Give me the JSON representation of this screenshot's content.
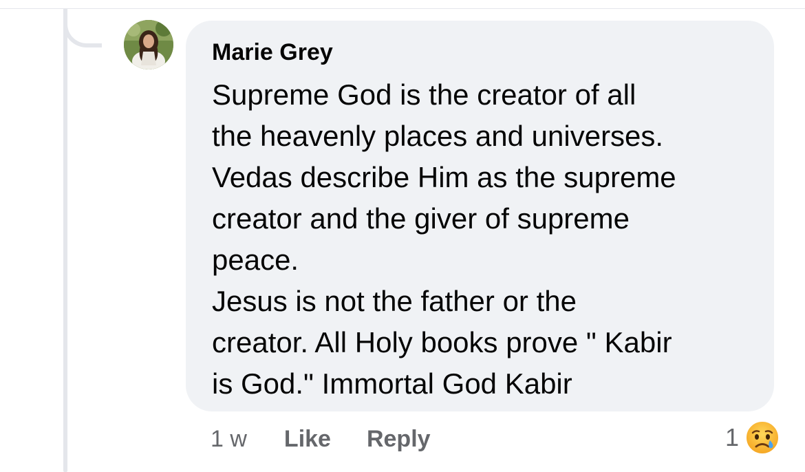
{
  "comment": {
    "author": "Marie Grey",
    "lines": [
      "Supreme God is the creator of all",
      "the heavenly places and universes.",
      "Vedas describe Him as the supreme",
      "creator and the giver of supreme",
      "peace.",
      "Jesus is not the father or the",
      "creator. All Holy books prove \" Kabir",
      "is God.\" Immortal God Kabir"
    ],
    "avatar_icon": "profile-photo",
    "bubble_color": "#f0f2f5"
  },
  "actions": {
    "timestamp": "1 w",
    "like_label": "Like",
    "reply_label": "Reply"
  },
  "reactions": {
    "count": "1",
    "icon": "sad-face-icon"
  },
  "colors": {
    "meta_text": "#65676b",
    "primary_text": "#050505",
    "thread_line": "#e4e6eb"
  }
}
